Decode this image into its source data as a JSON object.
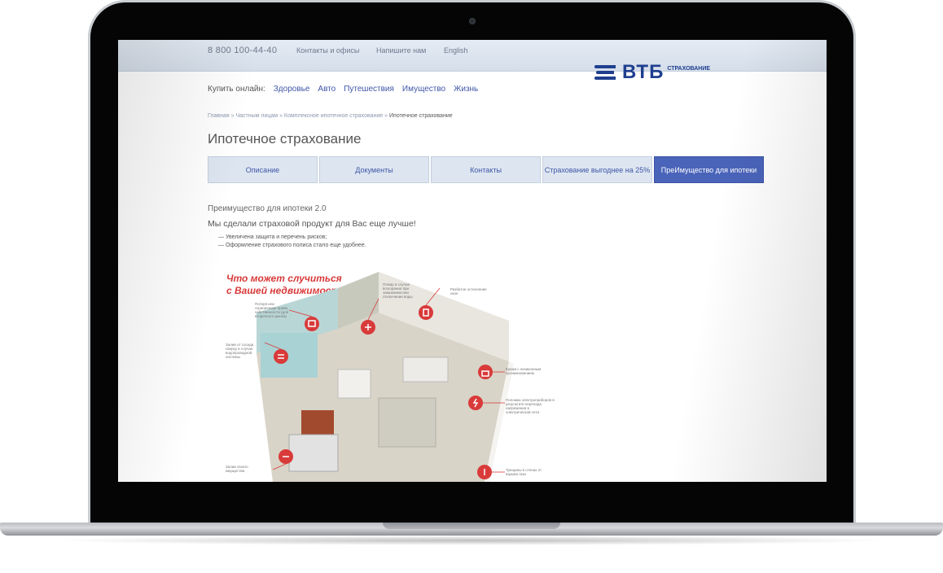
{
  "header": {
    "phone": "8 800 100-44-40",
    "links": [
      "Контакты и офисы",
      "Напишите нам",
      "English"
    ],
    "logo_text": "ВТБ",
    "logo_sub": "СТРАХОВАНИЕ"
  },
  "buy_online": {
    "label": "Купить онлайн:",
    "items": [
      "Здоровье",
      "Авто",
      "Путешествия",
      "Имущество",
      "Жизнь"
    ]
  },
  "breadcrumb": {
    "items": [
      "Главная",
      "Частным лицам",
      "Комплексное ипотечное страхование"
    ],
    "current": "Ипотечное страхование",
    "separator": "»"
  },
  "page_title": "Ипотечное страхование",
  "tabs": [
    {
      "label": "Описание",
      "active": false
    },
    {
      "label": "Документы",
      "active": false
    },
    {
      "label": "Контакты",
      "active": false
    },
    {
      "label": "Страхование выгоднее на 25%",
      "active": false
    },
    {
      "label": "ПреИмущество для ипотеки",
      "active": true
    }
  ],
  "content": {
    "subtitle": "Преимущество для ипотеки 2.0",
    "lead": "Мы сделали страховой продукт для Вас еще лучше!",
    "bullets": [
      "Увеличена защита и перечень рисков;",
      "Оформление страхового полиса стало еще удобнее."
    ]
  },
  "infographic": {
    "title_line1": "Что может случиться",
    "title_line2": "с Вашей недвижимостью?",
    "callouts": [
      "Потеря или ограничение права собственности (для вторичного рынка)",
      "Пожар в случае возгорания при замыкании или отключении воды",
      "Разбитое остекление окон",
      "Залив от соседа сверху в случае водопроводной системы",
      "Кража с незаконным проникновением",
      "Поломка электроприборов в результате перепада напряжения в электрической сети",
      "Залив своего имущества",
      "Трещины в стенах от взрыва газа"
    ]
  },
  "colors": {
    "brand": "#1f3f8f",
    "link": "#3f56a8",
    "accent_red": "#d93a3a",
    "active_tab": "#4a64ba"
  }
}
